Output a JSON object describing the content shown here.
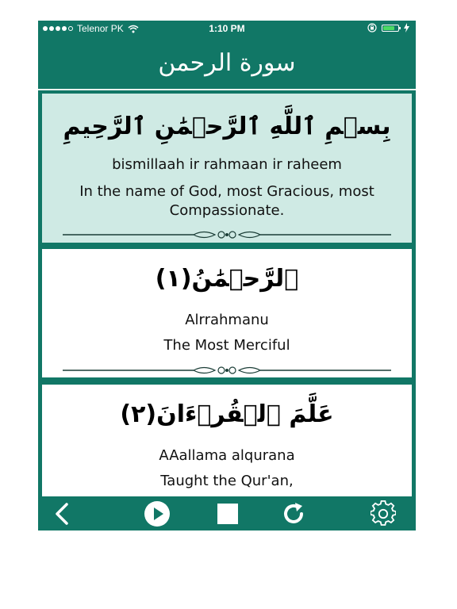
{
  "status_bar": {
    "carrier": "Telenor PK",
    "time": "1:10 PM",
    "battery_level": 0.75,
    "signal_bars": 4
  },
  "title_bar": {
    "title": "سورة الرحمن"
  },
  "verses": [
    {
      "arabic": "بِسۡمِ ٱللَّهِ ٱلرَّحۡمَٰنِ ٱلرَّحِيمِ",
      "transliteration": "bismillaah ir rahmaan ir raheem",
      "translation_line1": "In the name of God, most Gracious, most",
      "translation_line2": "Compassionate."
    },
    {
      "arabic": "ٱلرَّحۡمَٰنُ(١)",
      "transliteration": "Alrrahmanu",
      "translation_line1": "The Most Merciful"
    },
    {
      "arabic": "عَلَّمَ ٱلۡقُرۡءَانَ(٢)",
      "transliteration": "AAallama alqurana",
      "translation_line1": "Taught the Qur'an,"
    }
  ],
  "toolbar": {
    "icons": [
      "chevron-left-icon",
      "play-icon",
      "stop-icon",
      "refresh-icon",
      "gear-icon"
    ]
  },
  "colors": {
    "brand": "#117766",
    "highlight": "#cfeae4"
  }
}
